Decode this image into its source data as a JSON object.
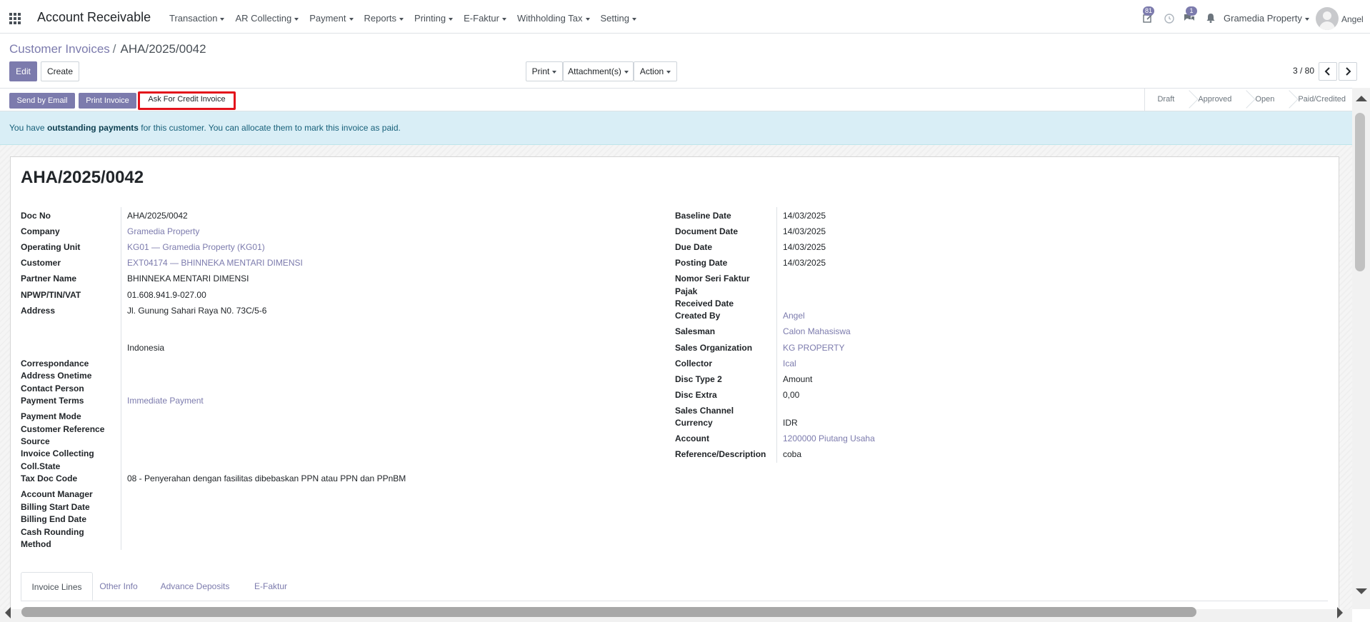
{
  "navbar": {
    "app_title": "Account Receivable",
    "menu": [
      "Transaction",
      "AR Collecting",
      "Payment",
      "Reports",
      "Printing",
      "E-Faktur",
      "Withholding Tax",
      "Setting"
    ],
    "activity_count": "81",
    "messages_count": "1",
    "company": "Gramedia Property",
    "user": "Angel"
  },
  "breadcrumb": {
    "parent": "Customer Invoices",
    "separator": "/",
    "current": "AHA/2025/0042"
  },
  "buttons": {
    "edit": "Edit",
    "create": "Create",
    "print": "Print",
    "attachments": "Attachment(s)",
    "action": "Action"
  },
  "pager": {
    "value": "3 / 80"
  },
  "statusbar": {
    "send_email": "Send by Email",
    "print_invoice": "Print Invoice",
    "ask_credit": "Ask For Credit Invoice",
    "stages": [
      "Draft",
      "Approved",
      "Open",
      "Paid/Credited"
    ]
  },
  "alert": {
    "prefix": "You have ",
    "bold": "outstanding payments",
    "suffix": " for this customer. You can allocate them to mark this invoice as paid."
  },
  "form": {
    "title": "AHA/2025/0042",
    "left_fields": {
      "doc_no": {
        "label": "Doc No",
        "value": "AHA/2025/0042"
      },
      "company": {
        "label": "Company",
        "value": "Gramedia Property"
      },
      "operating_unit": {
        "label": "Operating Unit",
        "value": "KG01 — Gramedia Property (KG01)"
      },
      "customer": {
        "label": "Customer",
        "value": "EXT04174 — BHINNEKA MENTARI DIMENSI"
      },
      "partner_name": {
        "label": "Partner Name",
        "value": "BHINNEKA MENTARI DIMENSI"
      },
      "npwp": {
        "label": "NPWP/TIN/VAT",
        "value": "01.608.941.9-027.00"
      },
      "address": {
        "label": "Address",
        "value": "Jl. Gunung Sahari Raya N0. 73C/5-6",
        "country": "Indonesia"
      },
      "correspondance": {
        "label": "Correspondance"
      },
      "address_onetime": {
        "label": "Address Onetime"
      },
      "contact_person": {
        "label": "Contact Person"
      },
      "payment_terms": {
        "label": "Payment Terms",
        "value": "Immediate Payment"
      },
      "payment_mode": {
        "label": "Payment Mode"
      },
      "customer_reference": {
        "label": "Customer Reference"
      },
      "source": {
        "label": "Source"
      },
      "invoice_collecting": {
        "label": "Invoice Collecting"
      },
      "coll_state": {
        "label": "Coll.State"
      },
      "tax_doc_code": {
        "label": "Tax Doc Code",
        "value": "08 - Penyerahan dengan fasilitas dibebaskan PPN atau PPN dan PPnBM"
      },
      "account_manager": {
        "label": "Account Manager"
      },
      "billing_start": {
        "label": "Billing Start Date"
      },
      "billing_end": {
        "label": "Billing End Date"
      },
      "cash_rounding_1": {
        "label": "Cash Rounding"
      },
      "cash_rounding_2": {
        "label": "Method"
      }
    },
    "right_fields": {
      "baseline_date": {
        "label": "Baseline Date",
        "value": "14/03/2025"
      },
      "document_date": {
        "label": "Document Date",
        "value": "14/03/2025"
      },
      "due_date": {
        "label": "Due Date",
        "value": "14/03/2025"
      },
      "posting_date": {
        "label": "Posting Date",
        "value": "14/03/2025"
      },
      "nomor_seri_1": {
        "label": "Nomor Seri Faktur"
      },
      "nomor_seri_2": {
        "label": "Pajak"
      },
      "received_date": {
        "label": "Received Date"
      },
      "created_by": {
        "label": "Created By",
        "value": "Angel"
      },
      "salesman": {
        "label": "Salesman",
        "value": "Calon Mahasiswa"
      },
      "sales_org": {
        "label": "Sales Organization",
        "value": "KG PROPERTY"
      },
      "collector": {
        "label": "Collector",
        "value": "Ical"
      },
      "disc_type_2": {
        "label": "Disc Type 2",
        "value": "Amount"
      },
      "disc_extra": {
        "label": "Disc Extra",
        "value": "0,00"
      },
      "sales_channel": {
        "label": "Sales Channel"
      },
      "currency": {
        "label": "Currency",
        "value": "IDR"
      },
      "account": {
        "label": "Account",
        "value": "1200000 Piutang Usaha"
      },
      "reference": {
        "label": "Reference/Description",
        "value": "coba"
      }
    },
    "tabs": [
      "Invoice Lines",
      "Other Info",
      "Advance Deposits",
      "E-Faktur"
    ]
  }
}
